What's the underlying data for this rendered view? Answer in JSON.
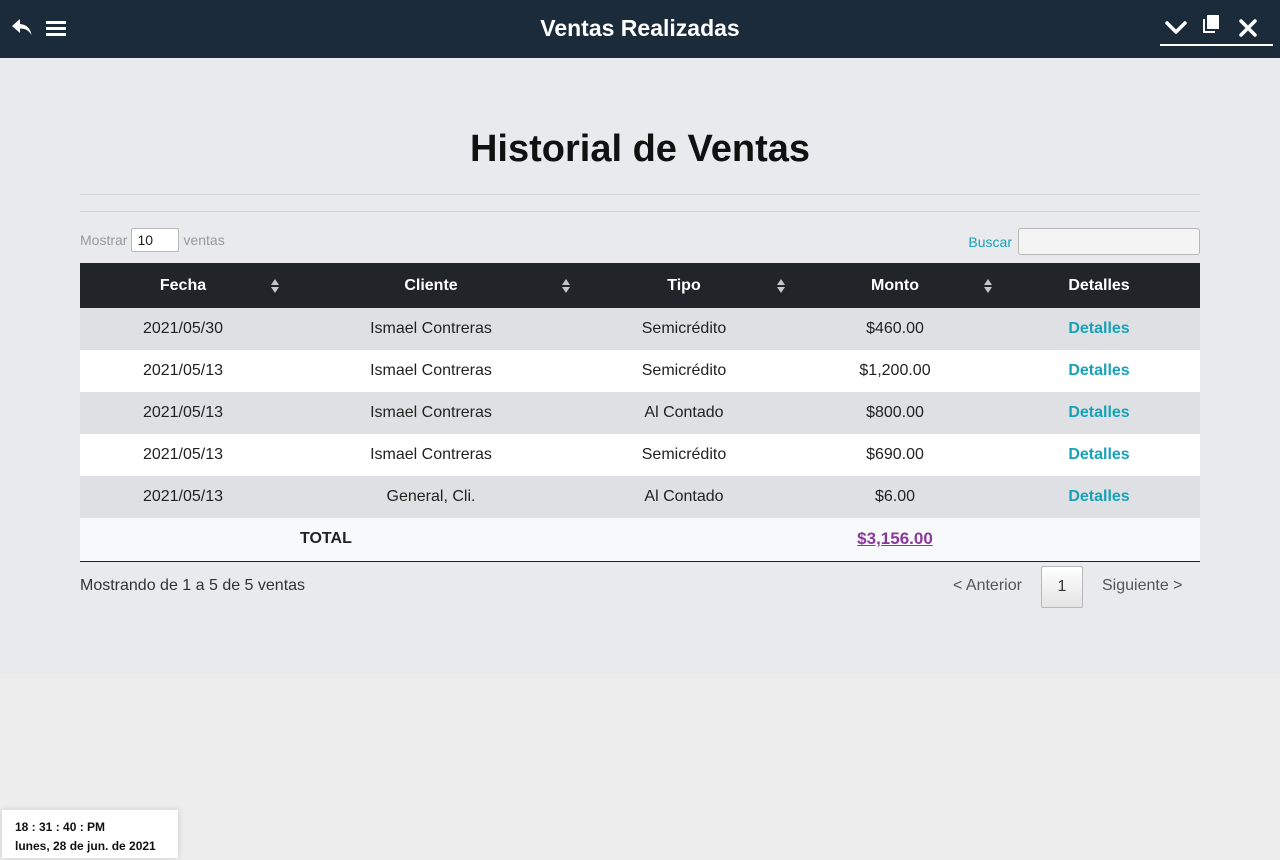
{
  "topbar": {
    "title": "Ventas Realizadas",
    "left_icons": [
      "back-arrow-icon",
      "hamburger-menu-icon"
    ],
    "right_icons": [
      "chevron-down-icon",
      "restore-window-icon",
      "close-icon"
    ],
    "background": "#1c2b3a"
  },
  "main": {
    "heading": "Historial de Ventas",
    "show_label": "Mostrar",
    "show_value": "10",
    "show_suffix": "ventas",
    "search_label": "Buscar",
    "search_value": ""
  },
  "table": {
    "columns": [
      "Fecha",
      "Cliente",
      "Tipo",
      "Monto",
      "Detalles"
    ],
    "rows": [
      {
        "fecha": "2021/05/30",
        "cliente": "Ismael Contreras",
        "tipo": "Semicrédito",
        "monto": "$460.00",
        "detalles": "Detalles"
      },
      {
        "fecha": "2021/05/13",
        "cliente": "Ismael Contreras",
        "tipo": "Semicrédito",
        "monto": "$1,200.00",
        "detalles": "Detalles"
      },
      {
        "fecha": "2021/05/13",
        "cliente": "Ismael Contreras",
        "tipo": "Al Contado",
        "monto": "$800.00",
        "detalles": "Detalles"
      },
      {
        "fecha": "2021/05/13",
        "cliente": "Ismael Contreras",
        "tipo": "Semicrédito",
        "monto": "$690.00",
        "detalles": "Detalles"
      },
      {
        "fecha": "2021/05/13",
        "cliente": "General, Cli.",
        "tipo": "Al Contado",
        "monto": "$6.00",
        "detalles": "Detalles"
      }
    ],
    "total_label": "TOTAL",
    "total_value": "$3,156.00"
  },
  "footer": {
    "info": "Mostrando de 1 a 5 de 5 ventas",
    "prev": "< Anterior",
    "page": "1",
    "next": "Siguiente >"
  },
  "clock": {
    "time": "18 : 31 : 40 : PM",
    "date": "lunes, 28 de jun. de 2021"
  },
  "colors": {
    "header_bg": "#212529",
    "link": "#17a2b8",
    "total": "#8a3a9c"
  }
}
